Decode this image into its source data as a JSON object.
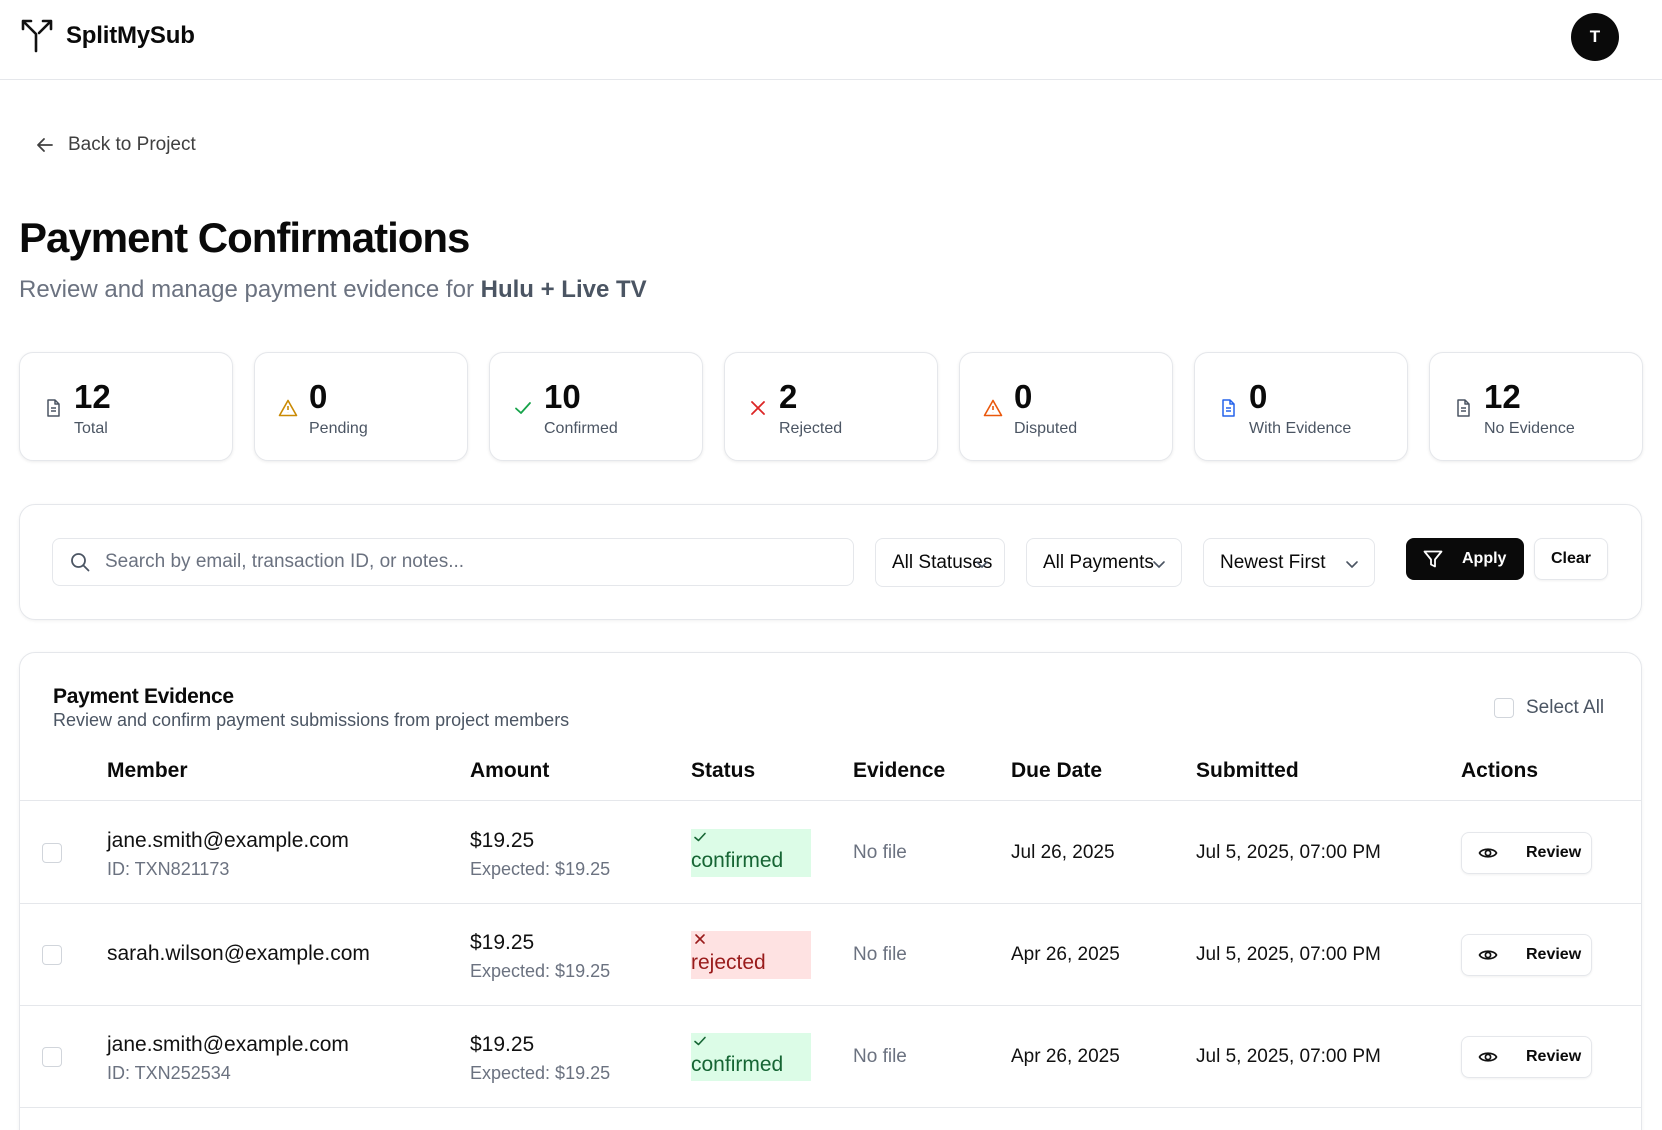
{
  "app": {
    "name": "SplitMySub",
    "avatar_initial": "T"
  },
  "nav": {
    "back_label": "Back to Project"
  },
  "page": {
    "title": "Payment Confirmations",
    "subtitle_prefix": "Review and manage payment evidence for ",
    "project_name": "Hulu + Live TV"
  },
  "stats": [
    {
      "value": "12",
      "label": "Total",
      "icon": "file-icon",
      "color": "#4b5563"
    },
    {
      "value": "0",
      "label": "Pending",
      "icon": "alert-triangle-icon",
      "color": "#ca8a04"
    },
    {
      "value": "10",
      "label": "Confirmed",
      "icon": "check-icon",
      "color": "#16a34a"
    },
    {
      "value": "2",
      "label": "Rejected",
      "icon": "x-icon",
      "color": "#dc2626"
    },
    {
      "value": "0",
      "label": "Disputed",
      "icon": "alert-triangle-icon",
      "color": "#ea580c"
    },
    {
      "value": "0",
      "label": "With Evidence",
      "icon": "file-text-icon",
      "color": "#2563eb"
    },
    {
      "value": "12",
      "label": "No Evidence",
      "icon": "file-text-icon",
      "color": "#4b5563"
    }
  ],
  "filters": {
    "search_placeholder": "Search by email, transaction ID, or notes...",
    "status": "All Statuses",
    "payments": "All Payments",
    "sort": "Newest First",
    "apply_label": "Apply",
    "clear_label": "Clear"
  },
  "evidence": {
    "title": "Payment Evidence",
    "description": "Review and confirm payment submissions from project members",
    "select_all_label": "Select All",
    "columns": [
      "Member",
      "Amount",
      "Status",
      "Evidence",
      "Due Date",
      "Submitted",
      "Actions"
    ],
    "rows": [
      {
        "email": "jane.smith@example.com",
        "txn": "ID: TXN821173",
        "amount": "$19.25",
        "expected": "Expected: $19.25",
        "status": "confirmed",
        "evidence": "No file",
        "due": "Jul 26, 2025",
        "submitted": "Jul 5, 2025, 07:00 PM",
        "action": "Review"
      },
      {
        "email": "sarah.wilson@example.com",
        "txn": "",
        "amount": "$19.25",
        "expected": "Expected: $19.25",
        "status": "rejected",
        "evidence": "No file",
        "due": "Apr 26, 2025",
        "submitted": "Jul 5, 2025, 07:00 PM",
        "action": "Review"
      },
      {
        "email": "jane.smith@example.com",
        "txn": "ID: TXN252534",
        "amount": "$19.25",
        "expected": "Expected: $19.25",
        "status": "confirmed",
        "evidence": "No file",
        "due": "Apr 26, 2025",
        "submitted": "Jul 5, 2025, 07:00 PM",
        "action": "Review"
      }
    ]
  }
}
